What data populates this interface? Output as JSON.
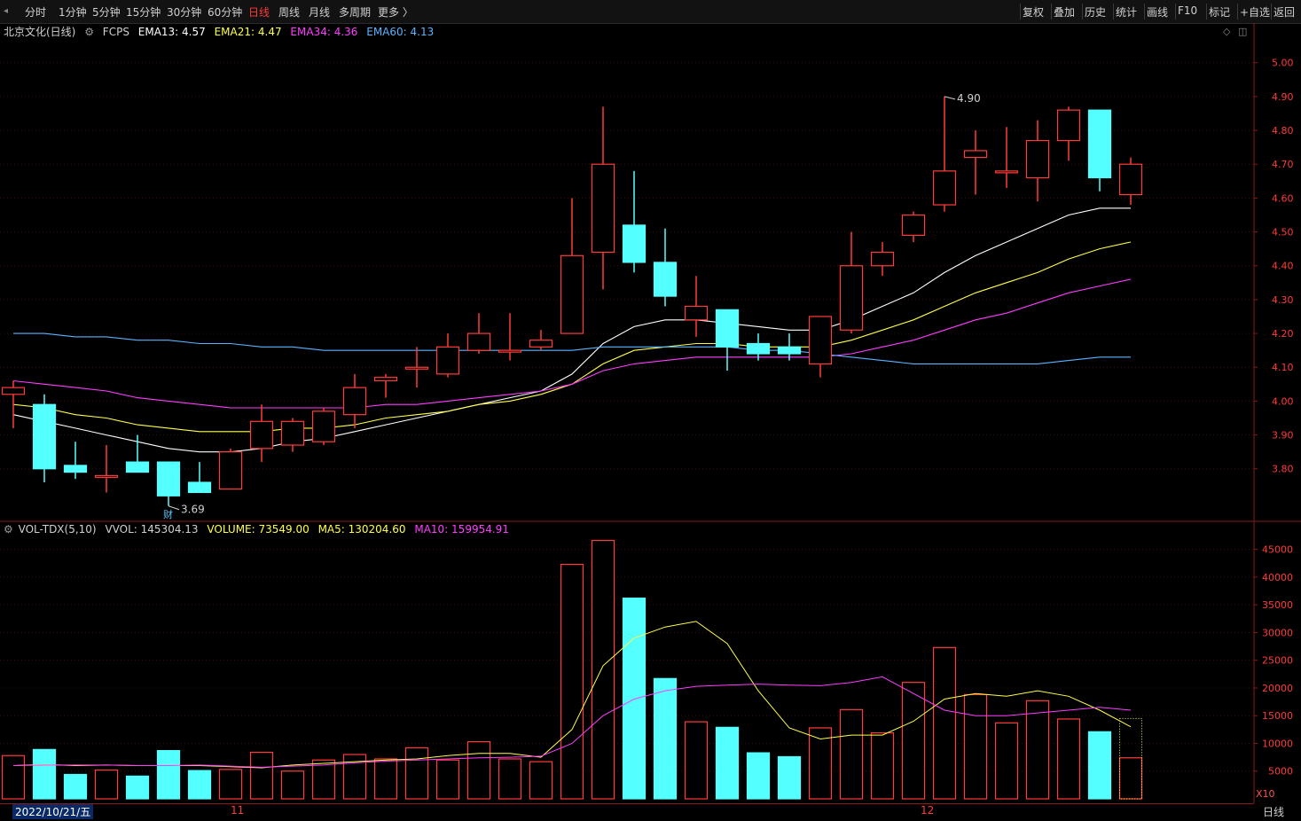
{
  "toolbar": {
    "periods": [
      "分时",
      "1分钟",
      "5分钟",
      "15分钟",
      "30分钟",
      "60分钟",
      "日线",
      "周线",
      "月线",
      "多周期",
      "更多 〉"
    ],
    "active_period": "日线",
    "tools": [
      "复权",
      "叠加",
      "历史",
      "统计",
      "画线",
      "F10",
      "标记",
      "+自选",
      "返回"
    ]
  },
  "price_info": {
    "stock": "北京文化(日线)",
    "indicator": "FCPS",
    "ema13": "EMA13: 4.57",
    "ema21": "EMA21: 4.47",
    "ema34": "EMA34: 4.36",
    "ema60": "EMA60: 4.13"
  },
  "volume_info": {
    "indicator": "VOL-TDX(5,10)",
    "vvol": "VVOL: 145304.13",
    "volume": "VOLUME: 73549.00",
    "ma5": "MA5: 130204.60",
    "ma10": "MA10: 159954.91"
  },
  "annotations": {
    "high_label": "4.90",
    "low_label": "3.69",
    "fin_marker": "财"
  },
  "footer": {
    "date": "2022/10/21/五",
    "month_nov": "11",
    "month_dec": "12",
    "period_label": "日线",
    "scale_label": "X10"
  },
  "colors": {
    "up": "#ff3b3b",
    "down": "#54ffff",
    "ema13": "#ffffff",
    "ema21": "#ffff4a",
    "ema34": "#ff3cff",
    "ema60": "#5ab4ff",
    "ma5": "#ffff4a",
    "ma10": "#ff3cff"
  },
  "chart_data": [
    {
      "type": "candlestick",
      "yticks": [
        "5.00",
        "4.90",
        "4.80",
        "4.70",
        "4.60",
        "4.50",
        "4.40",
        "4.30",
        "4.20",
        "4.10",
        "4.00",
        "3.90",
        "3.80"
      ],
      "ylim": [
        3.65,
        5.07
      ],
      "candles": [
        {
          "o": 4.02,
          "h": 4.06,
          "l": 3.92,
          "c": 4.04
        },
        {
          "o": 3.99,
          "h": 4.02,
          "l": 3.76,
          "c": 3.8
        },
        {
          "o": 3.81,
          "h": 3.88,
          "l": 3.77,
          "c": 3.79
        },
        {
          "o": 3.78,
          "h": 3.87,
          "l": 3.73,
          "c": 3.78
        },
        {
          "o": 3.82,
          "h": 3.9,
          "l": 3.79,
          "c": 3.79
        },
        {
          "o": 3.82,
          "h": 3.82,
          "l": 3.69,
          "c": 3.72
        },
        {
          "o": 3.76,
          "h": 3.82,
          "l": 3.73,
          "c": 3.73
        },
        {
          "o": 3.74,
          "h": 3.86,
          "l": 3.74,
          "c": 3.85
        },
        {
          "o": 3.86,
          "h": 3.99,
          "l": 3.82,
          "c": 3.94
        },
        {
          "o": 3.87,
          "h": 3.95,
          "l": 3.85,
          "c": 3.94
        },
        {
          "o": 3.88,
          "h": 3.98,
          "l": 3.87,
          "c": 3.97
        },
        {
          "o": 3.96,
          "h": 4.08,
          "l": 3.92,
          "c": 4.04
        },
        {
          "o": 4.06,
          "h": 4.08,
          "l": 4.01,
          "c": 4.07
        },
        {
          "o": 4.1,
          "h": 4.16,
          "l": 4.04,
          "c": 4.1
        },
        {
          "o": 4.08,
          "h": 4.2,
          "l": 4.07,
          "c": 4.16
        },
        {
          "o": 4.15,
          "h": 4.26,
          "l": 4.14,
          "c": 4.2
        },
        {
          "o": 4.15,
          "h": 4.26,
          "l": 4.12,
          "c": 4.15
        },
        {
          "o": 4.16,
          "h": 4.21,
          "l": 4.15,
          "c": 4.18
        },
        {
          "o": 4.2,
          "h": 4.6,
          "l": 4.2,
          "c": 4.43
        },
        {
          "o": 4.44,
          "h": 4.87,
          "l": 4.33,
          "c": 4.7
        },
        {
          "o": 4.52,
          "h": 4.68,
          "l": 4.38,
          "c": 4.41
        },
        {
          "o": 4.41,
          "h": 4.51,
          "l": 4.28,
          "c": 4.31
        },
        {
          "o": 4.24,
          "h": 4.37,
          "l": 4.19,
          "c": 4.28
        },
        {
          "o": 4.27,
          "h": 4.27,
          "l": 4.09,
          "c": 4.16
        },
        {
          "o": 4.17,
          "h": 4.2,
          "l": 4.12,
          "c": 4.14
        },
        {
          "o": 4.16,
          "h": 4.2,
          "l": 4.12,
          "c": 4.14
        },
        {
          "o": 4.11,
          "h": 4.25,
          "l": 4.07,
          "c": 4.25
        },
        {
          "o": 4.21,
          "h": 4.5,
          "l": 4.2,
          "c": 4.4
        },
        {
          "o": 4.4,
          "h": 4.47,
          "l": 4.37,
          "c": 4.44
        },
        {
          "o": 4.49,
          "h": 4.56,
          "l": 4.47,
          "c": 4.55
        },
        {
          "o": 4.58,
          "h": 4.9,
          "l": 4.56,
          "c": 4.68
        },
        {
          "o": 4.72,
          "h": 4.8,
          "l": 4.61,
          "c": 4.74
        },
        {
          "o": 4.68,
          "h": 4.81,
          "l": 4.63,
          "c": 4.68
        },
        {
          "o": 4.66,
          "h": 4.83,
          "l": 4.59,
          "c": 4.77
        },
        {
          "o": 4.77,
          "h": 4.87,
          "l": 4.71,
          "c": 4.86
        },
        {
          "o": 4.86,
          "h": 4.86,
          "l": 4.62,
          "c": 4.66
        },
        {
          "o": 4.61,
          "h": 4.72,
          "l": 4.58,
          "c": 4.7
        }
      ],
      "series": [
        {
          "name": "EMA13",
          "values": [
            3.96,
            3.94,
            3.92,
            3.9,
            3.88,
            3.86,
            3.85,
            3.85,
            3.86,
            3.88,
            3.89,
            3.91,
            3.93,
            3.95,
            3.97,
            3.99,
            4.01,
            4.03,
            4.08,
            4.17,
            4.22,
            4.24,
            4.24,
            4.23,
            4.22,
            4.21,
            4.21,
            4.24,
            4.28,
            4.32,
            4.38,
            4.43,
            4.47,
            4.51,
            4.55,
            4.57,
            4.57
          ]
        },
        {
          "name": "EMA21",
          "values": [
            3.99,
            3.98,
            3.96,
            3.95,
            3.93,
            3.92,
            3.91,
            3.91,
            3.91,
            3.92,
            3.92,
            3.93,
            3.95,
            3.96,
            3.97,
            3.99,
            4.0,
            4.02,
            4.05,
            4.11,
            4.15,
            4.16,
            4.17,
            4.17,
            4.16,
            4.16,
            4.16,
            4.18,
            4.21,
            4.24,
            4.28,
            4.32,
            4.35,
            4.38,
            4.42,
            4.45,
            4.47
          ]
        },
        {
          "name": "EMA34",
          "values": [
            4.06,
            4.05,
            4.04,
            4.03,
            4.01,
            4.0,
            3.99,
            3.98,
            3.98,
            3.98,
            3.98,
            3.98,
            3.99,
            3.99,
            4.0,
            4.01,
            4.02,
            4.03,
            4.05,
            4.09,
            4.11,
            4.12,
            4.13,
            4.13,
            4.13,
            4.13,
            4.13,
            4.14,
            4.16,
            4.18,
            4.21,
            4.24,
            4.26,
            4.29,
            4.32,
            4.34,
            4.36
          ]
        },
        {
          "name": "EMA60",
          "values": [
            4.2,
            4.2,
            4.19,
            4.19,
            4.18,
            4.18,
            4.17,
            4.17,
            4.16,
            4.16,
            4.15,
            4.15,
            4.15,
            4.15,
            4.15,
            4.15,
            4.15,
            4.15,
            4.15,
            4.16,
            4.16,
            4.16,
            4.16,
            4.16,
            4.15,
            4.15,
            4.14,
            4.13,
            4.12,
            4.11,
            4.11,
            4.11,
            4.11,
            4.11,
            4.12,
            4.13,
            4.13
          ]
        }
      ]
    },
    {
      "type": "bar",
      "yticks": [
        "45000",
        "40000",
        "35000",
        "30000",
        "25000",
        "20000",
        "15000",
        "10000",
        "5000"
      ],
      "ylim": [
        0,
        47500
      ],
      "volumes": [
        7800,
        8900,
        4400,
        5200,
        4100,
        8700,
        5100,
        5300,
        8400,
        5000,
        7000,
        8000,
        7200,
        9200,
        7000,
        10300,
        7200,
        6700,
        42300,
        46600,
        36200,
        21700,
        13900,
        12900,
        8300,
        7600,
        12800,
        16100,
        11900,
        21000,
        27300,
        18800,
        13700,
        17700,
        14400,
        12100,
        7400
      ],
      "series": [
        {
          "name": "MA5",
          "values": [
            6000,
            6200,
            6000,
            6100,
            6000,
            6000,
            6000,
            5800,
            5600,
            6100,
            6400,
            6700,
            7000,
            7200,
            7800,
            8200,
            8200,
            7500,
            12500,
            24000,
            29000,
            31000,
            32000,
            28000,
            19500,
            12800,
            10800,
            11500,
            11500,
            14000,
            18000,
            19000,
            18500,
            19500,
            18500,
            16000,
            13000
          ]
        },
        {
          "name": "MA10",
          "values": [
            6000,
            6100,
            6100,
            6100,
            6000,
            6000,
            6100,
            5900,
            5700,
            5900,
            6100,
            6500,
            6800,
            7000,
            7200,
            7400,
            7500,
            7700,
            10000,
            15000,
            18000,
            19500,
            20300,
            20500,
            20700,
            20500,
            20400,
            21000,
            22000,
            19000,
            16000,
            15000,
            15000,
            15500,
            16000,
            16500,
            16000
          ]
        }
      ]
    }
  ]
}
